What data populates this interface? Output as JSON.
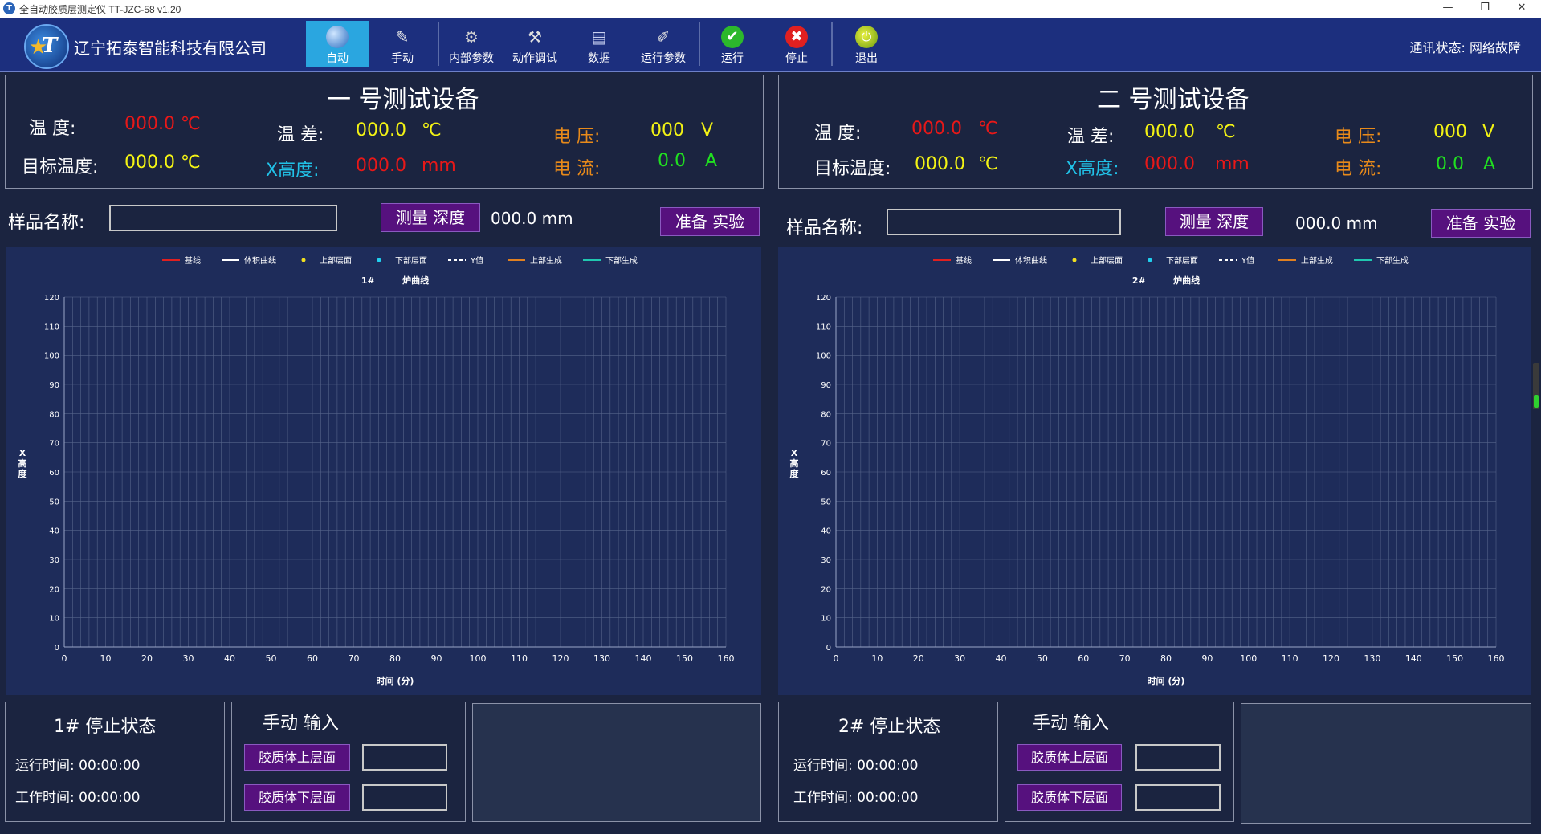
{
  "window": {
    "title": "全自动胶质层测定仪 TT-JZC-58  v1.20",
    "app_icon": "T"
  },
  "toolbar": {
    "company": "辽宁拓泰智能科技有限公司",
    "buttons": [
      {
        "label": "自动",
        "icon": "globe-icon"
      },
      {
        "label": "手动",
        "icon": "hand-tool-icon"
      },
      {
        "label": "内部参数",
        "icon": "gear-icon"
      },
      {
        "label": "动作调试",
        "icon": "tools-icon"
      },
      {
        "label": "数据",
        "icon": "book-icon"
      },
      {
        "label": "运行参数",
        "icon": "notepad-icon"
      },
      {
        "label": "运行",
        "icon": "check-icon"
      },
      {
        "label": "停止",
        "icon": "stop-icon"
      },
      {
        "label": "退出",
        "icon": "exit-icon"
      }
    ],
    "comm_status": "通讯状态: 网络故障"
  },
  "devices": [
    {
      "title": "一 号测试设备",
      "temp_label": "温 度:",
      "temp_value": "000.0 ℃",
      "target_label": "目标温度:",
      "target_value": "000.0 ℃",
      "diff_label": "温 差:",
      "diff_value": "000.0",
      "diff_unit": "℃",
      "height_label": "X高度:",
      "height_value": "000.0",
      "height_unit": "mm",
      "voltage_label": "电 压:",
      "voltage_value": "000",
      "voltage_unit": "V",
      "current_label": "电 流:",
      "current_value": "0.0",
      "current_unit": "A",
      "sample_label": "样品名称:",
      "measure_button": "测量 深度",
      "depth_value": "000.0 mm",
      "prepare_button": "准备 实验",
      "status_title": "1# 停止状态",
      "run_time": "运行时间: 00:00:00",
      "work_time": "工作时间: 00:00:00",
      "manual_title": "手动 输入",
      "upper_button": "胶质体上层面",
      "lower_button": "胶质体下层面"
    },
    {
      "title": "二 号测试设备",
      "temp_label": "温 度:",
      "temp_value": "000.0",
      "temp_unit": "℃",
      "target_label": "目标温度:",
      "target_value": "000.0",
      "target_unit": "℃",
      "diff_label": "温 差:",
      "diff_value": "000.0",
      "diff_unit": "℃",
      "height_label": "X高度:",
      "height_value": "000.0",
      "height_unit": "mm",
      "voltage_label": "电 压:",
      "voltage_value": "000",
      "voltage_unit": "V",
      "current_label": "电 流:",
      "current_value": "0.0",
      "current_unit": "A",
      "sample_label": "样品名称:",
      "measure_button": "测量 深度",
      "depth_value": "000.0 mm",
      "prepare_button": "准备 实验",
      "status_title": "2# 停止状态",
      "run_time": "运行时间: 00:00:00",
      "work_time": "工作时间: 00:00:00",
      "manual_title": "手动 输入",
      "upper_button": "胶质体上层面",
      "lower_button": "胶质体下层面"
    }
  ],
  "chart_data": [
    {
      "type": "line",
      "title": "1#         炉曲线",
      "xlabel": "时间 (分)",
      "ylabel": "X高度",
      "xlim": [
        0,
        160
      ],
      "ylim": [
        0,
        120
      ],
      "x_ticks": [
        0,
        10,
        20,
        30,
        40,
        50,
        60,
        70,
        80,
        90,
        100,
        110,
        120,
        130,
        140,
        150,
        160
      ],
      "y_ticks": [
        0,
        10,
        20,
        30,
        40,
        50,
        60,
        70,
        80,
        90,
        100,
        110,
        120
      ],
      "grid": true,
      "legend_position": "top",
      "legend": [
        {
          "name": "基线",
          "color": "#e02020",
          "style": "line"
        },
        {
          "name": "体积曲线",
          "color": "#ffffff",
          "style": "line"
        },
        {
          "name": "上部层面",
          "color": "#f0e020",
          "style": "dot"
        },
        {
          "name": "下部层面",
          "color": "#20d0f0",
          "style": "dot"
        },
        {
          "name": "Y值",
          "color": "#ffffff",
          "style": "dash"
        },
        {
          "name": "上部生成",
          "color": "#e08020",
          "style": "line"
        },
        {
          "name": "下部生成",
          "color": "#20c8b0",
          "style": "line"
        }
      ],
      "series": []
    },
    {
      "type": "line",
      "title": "2#         炉曲线",
      "xlabel": "时间 (分)",
      "ylabel": "X高度",
      "xlim": [
        0,
        160
      ],
      "ylim": [
        0,
        120
      ],
      "x_ticks": [
        0,
        10,
        20,
        30,
        40,
        50,
        60,
        70,
        80,
        90,
        100,
        110,
        120,
        130,
        140,
        150,
        160
      ],
      "y_ticks": [
        0,
        10,
        20,
        30,
        40,
        50,
        60,
        70,
        80,
        90,
        100,
        110,
        120
      ],
      "grid": true,
      "legend_position": "top",
      "legend": [
        {
          "name": "基线",
          "color": "#e02020",
          "style": "line"
        },
        {
          "name": "体积曲线",
          "color": "#ffffff",
          "style": "line"
        },
        {
          "name": "上部层面",
          "color": "#f0e020",
          "style": "dot"
        },
        {
          "name": "下部层面",
          "color": "#20d0f0",
          "style": "dot"
        },
        {
          "name": "Y值",
          "color": "#ffffff",
          "style": "dash"
        },
        {
          "name": "上部生成",
          "color": "#e08020",
          "style": "line"
        },
        {
          "name": "下部生成",
          "color": "#20c8b0",
          "style": "line"
        }
      ],
      "series": []
    }
  ]
}
